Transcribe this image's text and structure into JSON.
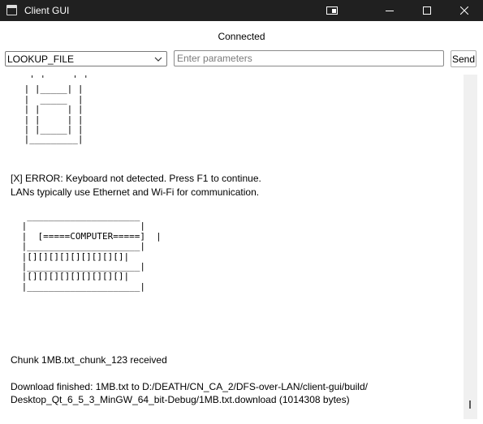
{
  "window": {
    "title": "Client GUI",
    "icons": {
      "app": "window-icon",
      "snap": "snap-layout-icon",
      "min": "minimize-icon",
      "max": "maximize-icon",
      "close": "close-icon"
    }
  },
  "status": {
    "text": "Connected"
  },
  "controls": {
    "command_value": "LOOKUP_FILE",
    "params_value": "",
    "params_placeholder": "Enter parameters",
    "send_label": "Send"
  },
  "output": {
    "art_pc_top": [
      "  ' '     ' '",
      " | |_____| |",
      " |  _____  |",
      " | |     | |",
      " | |     | |",
      " | |_____| |",
      " |_________|"
    ],
    "error_line": "[X] ERROR: Keyboard not detected. Press F1 to continue.",
    "lan_line": "LANs typically use Ethernet and Wi-Fi for communication.",
    "art_computer": [
      "  _____________________",
      " |                     |",
      " |  [=====COMPUTER=====]  |",
      " |_____________________|",
      " |[][][][][][][][][]|",
      " |_____________________|",
      " |[][][][][][][][][]|",
      " |_____________________|"
    ],
    "chunk_line": "Chunk 1MB.txt_chunk_123 received",
    "download_line1": "Download finished: 1MB.txt to D:/DEATH/CN_CA_2/DFS-over-LAN/client-gui/build/",
    "download_line2": "Desktop_Qt_6_5_3_MinGW_64_bit-Debug/1MB.txt.download (1014308 bytes)"
  }
}
